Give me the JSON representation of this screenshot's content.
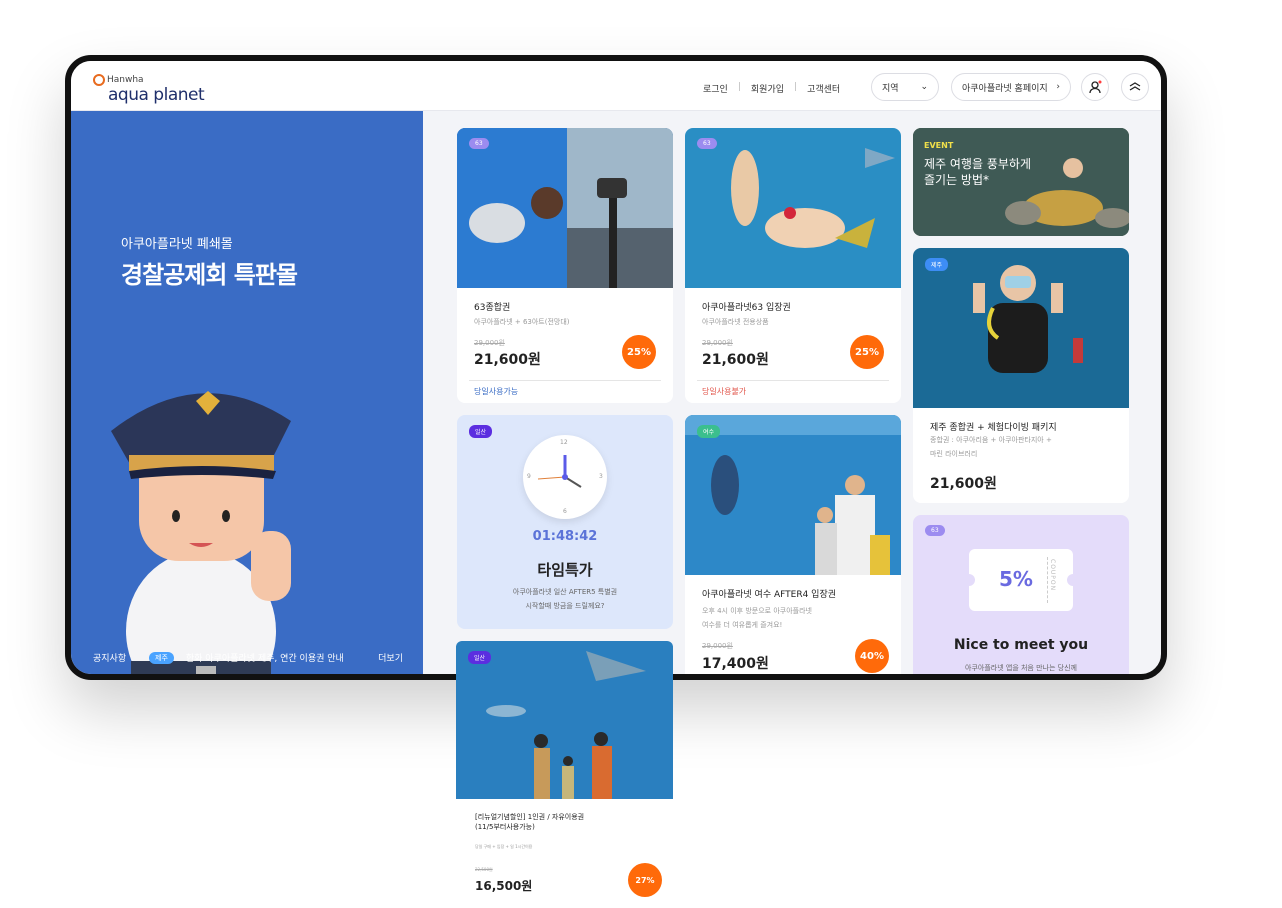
{
  "header": {
    "logo_brand": "Hanwha",
    "logo_name": "aqua planet",
    "nav": [
      "로그인",
      "회원가입",
      "고객센터"
    ],
    "region_label": "지역",
    "homepage_label": "아쿠아플라넷 홈페이지"
  },
  "hero": {
    "subtitle": "아쿠아플라넷 폐쇄몰",
    "title": "경찰공제회 특판몰"
  },
  "notice": {
    "label": "공지사항",
    "badge": "제주",
    "text": "한화 아쿠아플라넷 제주, 연간 이용권 안내",
    "more": "더보기"
  },
  "cards": {
    "c1": {
      "tag": "63",
      "name": "63종합권",
      "desc": "아쿠아플라넷 + 63아트(전망대)",
      "old_price": "29,000원",
      "price": "21,600원",
      "discount": "25%",
      "status": "당일사용가능"
    },
    "c2": {
      "tag": "63",
      "name": "아쿠아플라넷63 입장권",
      "desc": "아쿠아플라넷 전용상품",
      "old_price": "29,000원",
      "price": "21,600원",
      "discount": "25%",
      "status": "당일사용불가"
    },
    "c3": {
      "tag": "EVENT",
      "title1": "제주 여행을 풍부하게",
      "title2": "즐기는 방법*"
    },
    "c4": {
      "tag": "제주",
      "name": "제주 종합권 + 체험다이빙 패키지",
      "desc1": "종합권 : 아쿠아리움 + 아쿠아판타지아 +",
      "desc2": "마린 라이브러리",
      "price": "21,600원"
    },
    "timer": {
      "tag": "일산",
      "clock_12": "12",
      "clock_3": "3",
      "clock_6": "6",
      "clock_9": "9",
      "time": "01:48:42",
      "title": "타임특가",
      "desc1": "아쿠아플라넷 일산 AFTER5 특별권",
      "desc2": "시작할때 방금을 드릴께요?"
    },
    "c5": {
      "tag": "여수",
      "name": "아쿠아플라넷 여수 AFTER4 입장권",
      "desc1": "오후 4시 이후 방문으로 아쿠아플라넷",
      "desc2": "여수를 더 여유롭게 즐겨요!",
      "old_price": "29,000원",
      "price": "17,400원",
      "discount": "40%"
    },
    "coupon": {
      "tag": "63",
      "percent": "5%",
      "vertical": "COUPON",
      "title": "Nice to meet you",
      "desc": "아쿠아플라넷 앱을 처음 만나는 당신께"
    },
    "c6": {
      "tag": "일산",
      "name1": "[리뉴얼기념할인] 1인권 / 자유이용권",
      "name2": "(11/5부터사용가능)",
      "desc": "당일 구매 + 입장 + 일 1시간이용",
      "old_price": "22,500원",
      "price": "16,500원",
      "discount": "27%"
    }
  },
  "colors": {
    "blue_panel": "#3a6cc5",
    "discount": "#ff6a0a",
    "timer_bg": "#dde7fb",
    "coupon_bg": "#e4dcfa"
  }
}
